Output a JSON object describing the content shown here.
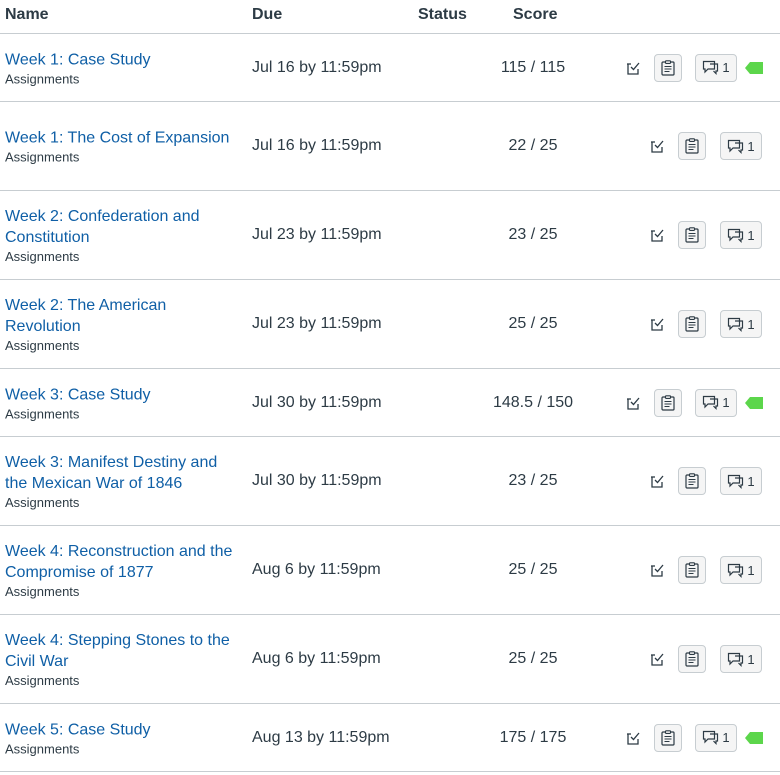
{
  "table": {
    "headers": {
      "name": "Name",
      "due": "Due",
      "status": "Status",
      "score": "Score"
    },
    "rows": [
      {
        "title": "Week 1: Case Study",
        "type": "Assignments",
        "due": "Jul 16 by 11:59pm",
        "score": "115 / 115",
        "comments": "1",
        "flagged": true
      },
      {
        "title": "Week 1: The Cost of Expansion",
        "type": "Assignments",
        "due": "Jul 16 by 11:59pm",
        "score": "22 / 25",
        "comments": "1",
        "flagged": false
      },
      {
        "title": "Week 2: Confederation and Constitution",
        "type": "Assignments",
        "due": "Jul 23 by 11:59pm",
        "score": "23 / 25",
        "comments": "1",
        "flagged": false
      },
      {
        "title": "Week 2: The American Revolution",
        "type": "Assignments",
        "due": "Jul 23 by 11:59pm",
        "score": "25 / 25",
        "comments": "1",
        "flagged": false
      },
      {
        "title": "Week 3: Case Study",
        "type": "Assignments",
        "due": "Jul 30 by 11:59pm",
        "score": "148.5 / 150",
        "comments": "1",
        "flagged": true
      },
      {
        "title": "Week 3: Manifest Destiny and the Mexican War of 1846",
        "type": "Assignments",
        "due": "Jul 30 by 11:59pm",
        "score": "23 / 25",
        "comments": "1",
        "flagged": false
      },
      {
        "title": "Week 4: Reconstruction and the Compromise of 1877",
        "type": "Assignments",
        "due": "Aug 6 by 11:59pm",
        "score": "25 / 25",
        "comments": "1",
        "flagged": false
      },
      {
        "title": "Week 4: Stepping Stones to the Civil War",
        "type": "Assignments",
        "due": "Aug 6 by 11:59pm",
        "score": "25 / 25",
        "comments": "1",
        "flagged": false
      },
      {
        "title": "Week 5: Case Study",
        "type": "Assignments",
        "due": "Aug 13 by 11:59pm",
        "score": "175 / 175",
        "comments": "1",
        "flagged": true
      }
    ]
  },
  "icons": {
    "whatif": "what-if-score-icon",
    "rubric": "rubric-icon",
    "comments": "comments-icon",
    "flag": "flag-icon"
  },
  "colors": {
    "link": "#0f5fa6",
    "flag": "#5cd64b",
    "border": "#c7cdd1"
  }
}
